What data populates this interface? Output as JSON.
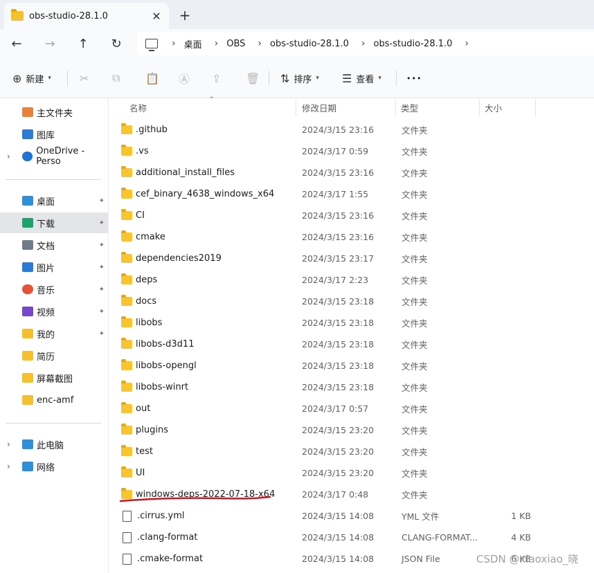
{
  "tab": {
    "title": "obs-studio-28.1.0",
    "close_glyph": "✕",
    "new_tab_glyph": "+"
  },
  "nav": {
    "back": "←",
    "forward": "→",
    "up": "↑",
    "refresh": "↻"
  },
  "breadcrumb": [
    "桌面",
    "OBS",
    "obs-studio-28.1.0",
    "obs-studio-28.1.0"
  ],
  "toolbar": {
    "new_label": "新建",
    "sort_label": "排序",
    "view_label": "查看",
    "more_label": "•••"
  },
  "sidebar": {
    "top_items": [
      {
        "label": "主文件夹",
        "icon": "home-icon",
        "color": "#e8823a"
      },
      {
        "label": "图库",
        "icon": "gallery-icon",
        "color": "#2b7bd4"
      },
      {
        "label": "OneDrive - Perso",
        "icon": "onedrive-icon",
        "color": "#1f74d3"
      }
    ],
    "pinned_items": [
      {
        "label": "桌面",
        "icon": "desktop-icon",
        "color": "#2f8fd8"
      },
      {
        "label": "下载",
        "icon": "download-icon",
        "color": "#1aa36a"
      },
      {
        "label": "文档",
        "icon": "documents-icon",
        "color": "#6f7a8a"
      },
      {
        "label": "图片",
        "icon": "pictures-icon",
        "color": "#2b7bd4"
      },
      {
        "label": "音乐",
        "icon": "music-icon",
        "color": "#e2533a"
      },
      {
        "label": "视频",
        "icon": "videos-icon",
        "color": "#7b45c9"
      },
      {
        "label": "我的",
        "icon": "folder-icon",
        "color": "#f4c02e"
      },
      {
        "label": "简历",
        "icon": "folder-icon",
        "color": "#f4c02e"
      },
      {
        "label": "屏幕截图",
        "icon": "folder-icon",
        "color": "#f4c02e"
      },
      {
        "label": "enc-amf",
        "icon": "folder-icon",
        "color": "#f4c02e"
      }
    ],
    "bottom_items": [
      {
        "label": "此电脑",
        "icon": "computer-icon",
        "color": "#2f8fd8"
      },
      {
        "label": "网络",
        "icon": "network-icon",
        "color": "#2f8fd8"
      }
    ],
    "pin_glyph": "📌",
    "expand_glyph": "›"
  },
  "columns": {
    "name": "名称",
    "date": "修改日期",
    "type": "类型",
    "size": "大小"
  },
  "files": [
    {
      "name": ".github",
      "date": "2024/3/15 23:16",
      "type": "文件夹",
      "size": "",
      "kind": "folder"
    },
    {
      "name": ".vs",
      "date": "2024/3/17 0:59",
      "type": "文件夹",
      "size": "",
      "kind": "folder"
    },
    {
      "name": "additional_install_files",
      "date": "2024/3/15 23:16",
      "type": "文件夹",
      "size": "",
      "kind": "folder"
    },
    {
      "name": "cef_binary_4638_windows_x64",
      "date": "2024/3/17 1:55",
      "type": "文件夹",
      "size": "",
      "kind": "folder"
    },
    {
      "name": "CI",
      "date": "2024/3/15 23:16",
      "type": "文件夹",
      "size": "",
      "kind": "folder"
    },
    {
      "name": "cmake",
      "date": "2024/3/15 23:16",
      "type": "文件夹",
      "size": "",
      "kind": "folder"
    },
    {
      "name": "dependencies2019",
      "date": "2024/3/15 23:17",
      "type": "文件夹",
      "size": "",
      "kind": "folder"
    },
    {
      "name": "deps",
      "date": "2024/3/17 2:23",
      "type": "文件夹",
      "size": "",
      "kind": "folder"
    },
    {
      "name": "docs",
      "date": "2024/3/15 23:18",
      "type": "文件夹",
      "size": "",
      "kind": "folder"
    },
    {
      "name": "libobs",
      "date": "2024/3/15 23:18",
      "type": "文件夹",
      "size": "",
      "kind": "folder"
    },
    {
      "name": "libobs-d3d11",
      "date": "2024/3/15 23:18",
      "type": "文件夹",
      "size": "",
      "kind": "folder"
    },
    {
      "name": "libobs-opengl",
      "date": "2024/3/15 23:18",
      "type": "文件夹",
      "size": "",
      "kind": "folder"
    },
    {
      "name": "libobs-winrt",
      "date": "2024/3/15 23:18",
      "type": "文件夹",
      "size": "",
      "kind": "folder"
    },
    {
      "name": "out",
      "date": "2024/3/17 0:57",
      "type": "文件夹",
      "size": "",
      "kind": "folder"
    },
    {
      "name": "plugins",
      "date": "2024/3/15 23:20",
      "type": "文件夹",
      "size": "",
      "kind": "folder"
    },
    {
      "name": "test",
      "date": "2024/3/15 23:20",
      "type": "文件夹",
      "size": "",
      "kind": "folder"
    },
    {
      "name": "UI",
      "date": "2024/3/15 23:20",
      "type": "文件夹",
      "size": "",
      "kind": "folder"
    },
    {
      "name": "windows-deps-2022-07-18-x64",
      "date": "2024/3/17 0:48",
      "type": "文件夹",
      "size": "",
      "kind": "folder"
    },
    {
      "name": ".cirrus.yml",
      "date": "2024/3/15 14:08",
      "type": "YML 文件",
      "size": "1 KB",
      "kind": "file"
    },
    {
      "name": ".clang-format",
      "date": "2024/3/15 14:08",
      "type": "CLANG-FORMAT...",
      "size": "4 KB",
      "kind": "file"
    },
    {
      "name": ".cmake-format",
      "date": "2024/3/15 14:08",
      "type": "JSON File",
      "size": "6 KB",
      "kind": "file"
    }
  ],
  "watermark": "CSDN @xiaoxiao_晓",
  "annotation_color": "#d9111c"
}
